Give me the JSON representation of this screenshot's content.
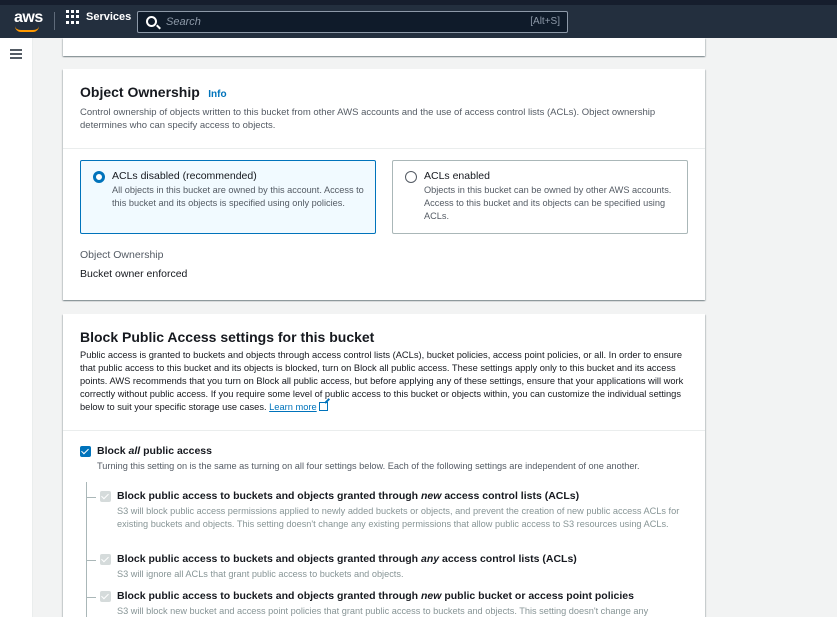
{
  "topbar": {
    "logo_text": "aws",
    "services_label": "Services",
    "search_placeholder": "Search",
    "search_shortcut": "[Alt+S]"
  },
  "ownership": {
    "title": "Object Ownership",
    "info": "Info",
    "description": "Control ownership of objects written to this bucket from other AWS accounts and the use of access control lists (ACLs). Object ownership determines who can specify access to objects.",
    "options": [
      {
        "label": "ACLs disabled (recommended)",
        "description": "All objects in this bucket are owned by this account. Access to this bucket and its objects is specified using only policies.",
        "selected": true
      },
      {
        "label": "ACLs enabled",
        "description": "Objects in this bucket can be owned by other AWS accounts. Access to this bucket and its objects can be specified using ACLs.",
        "selected": false
      }
    ],
    "field_label": "Object Ownership",
    "field_value": "Bucket owner enforced"
  },
  "bpa": {
    "title": "Block Public Access settings for this bucket",
    "description": "Public access is granted to buckets and objects through access control lists (ACLs), bucket policies, access point policies, or all. In order to ensure that public access to this bucket and its objects is blocked, turn on Block all public access. These settings apply only to this bucket and its access points. AWS recommends that you turn on Block all public access, but before applying any of these settings, ensure that your applications will work correctly without public access. If you require some level of public access to this bucket or objects within, you can customize the individual settings below to suit your specific storage use cases.",
    "learn_more": "Learn more",
    "block_all": {
      "label_pre": "Block ",
      "label_em": "all",
      "label_post": " public access",
      "description": "Turning this setting on is the same as turning on all four settings below. Each of the following settings are independent of one another.",
      "checked": true
    },
    "settings": [
      {
        "title_pre": "Block public access to buckets and objects granted through ",
        "title_em": "new",
        "title_post": " access control lists (ACLs)",
        "description": "S3 will block public access permissions applied to newly added buckets or objects, and prevent the creation of new public access ACLs for existing buckets and objects. This setting doesn't change any existing permissions that allow public access to S3 resources using ACLs."
      },
      {
        "title_pre": "Block public access to buckets and objects granted through ",
        "title_em": "any",
        "title_post": " access control lists (ACLs)",
        "description": "S3 will ignore all ACLs that grant public access to buckets and objects."
      },
      {
        "title_pre": "Block public access to buckets and objects granted through ",
        "title_em": "new",
        "title_post": " public bucket or access point policies",
        "description": "S3 will block new bucket and access point policies that grant public access to buckets and objects. This setting doesn't change any"
      }
    ]
  },
  "colors": {
    "nav_bg": "#232f3e",
    "accent": "#0073bb",
    "logo_smile": "#ff9900",
    "selected_tile_bg": "#f1faff"
  }
}
